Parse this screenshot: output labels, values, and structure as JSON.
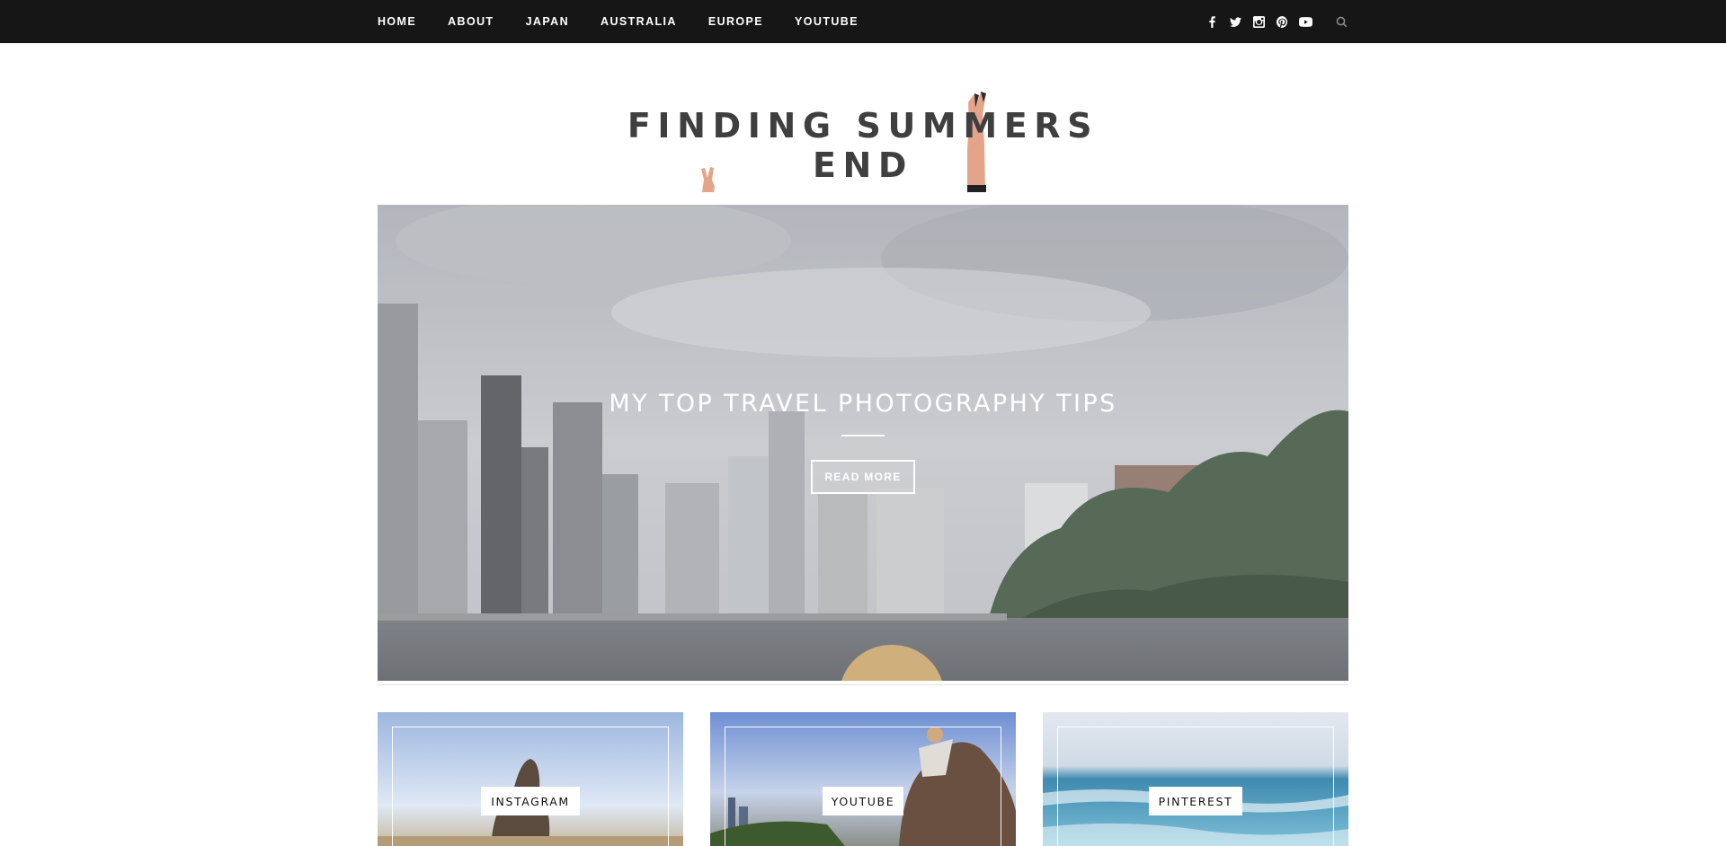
{
  "nav": {
    "items": [
      "HOME",
      "ABOUT",
      "JAPAN",
      "AUSTRALIA",
      "EUROPE",
      "YOUTUBE"
    ]
  },
  "social": {
    "icons": [
      "facebook-icon",
      "twitter-icon",
      "instagram-icon",
      "pinterest-icon",
      "youtube-icon",
      "search-icon"
    ]
  },
  "site": {
    "logo_text": "FINDING SUMMERS END"
  },
  "hero": {
    "title": "MY TOP TRAVEL PHOTOGRAPHY TIPS",
    "button_label": "READ MORE"
  },
  "tiles": [
    {
      "label": "INSTAGRAM"
    },
    {
      "label": "YOUTUBE"
    },
    {
      "label": "PINTEREST"
    }
  ],
  "colors": {
    "nav_bg": "#161616",
    "nav_text": "#ffffff",
    "logo_text": "#3f3f3f",
    "page_bg": "#ffffff"
  }
}
